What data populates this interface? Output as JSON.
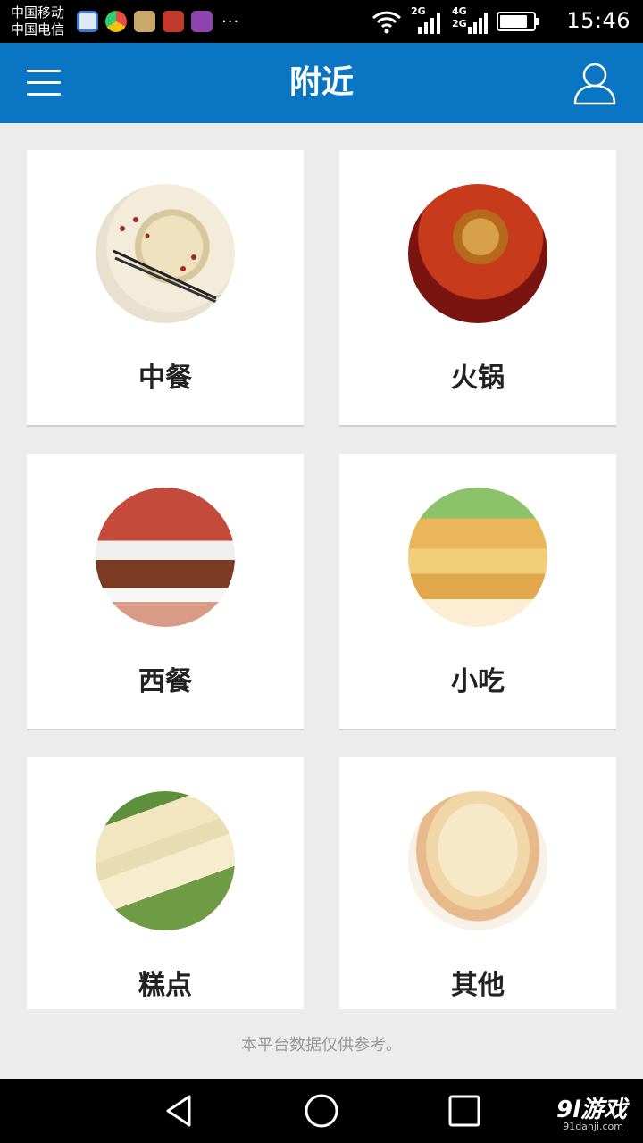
{
  "status_bar": {
    "carrier_1": "中国移动",
    "carrier_2": "中国电信",
    "overflow": "···",
    "net_1": "2G",
    "net_2": "4G",
    "net_3": "2G",
    "time": "15:46",
    "battery_level": 0.85
  },
  "header": {
    "title": "附近"
  },
  "categories": [
    {
      "label": "中餐"
    },
    {
      "label": "火锅"
    },
    {
      "label": "西餐"
    },
    {
      "label": "小吃"
    },
    {
      "label": "糕点"
    },
    {
      "label": "其他"
    }
  ],
  "footer": {
    "disclaimer": "本平台数据仅供参考。"
  },
  "watermark": {
    "brand": "9l游戏",
    "url": "91danji.com"
  },
  "colors": {
    "accent": "#0a75c2",
    "background": "#ececec"
  }
}
